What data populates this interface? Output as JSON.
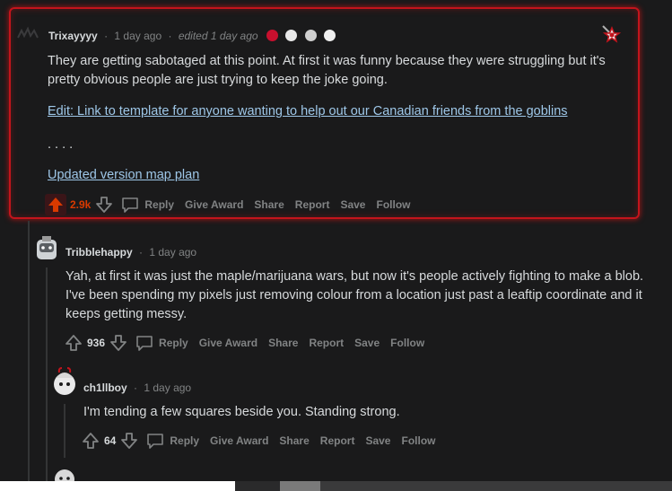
{
  "comments": [
    {
      "username": "Trixayyyy",
      "time": "1 day ago",
      "edited": "edited 1 day ago",
      "body": "They are getting sabotaged at this point. At first it was funny because they were struggling but it's pretty obvious people are just trying to keep the joke going.",
      "link1": "Edit: Link to template for anyone wanting to help out our Canadian friends from the goblins",
      "dots": ". . . .",
      "link2": "Updated version map plan",
      "score": "2.9k",
      "actions": {
        "reply": "Reply",
        "give_award": "Give Award",
        "share": "Share",
        "report": "Report",
        "save": "Save",
        "follow": "Follow"
      }
    },
    {
      "username": "Tribblehappy",
      "time": "1 day ago",
      "body": "Yah, at first it was just the maple/marijuana wars, but now it's people actively fighting to make a blob. I've been spending my pixels just removing colour from a location just past a leaftip coordinate and it keeps getting messy.",
      "score": "936",
      "actions": {
        "reply": "Reply",
        "give_award": "Give Award",
        "share": "Share",
        "report": "Report",
        "save": "Save",
        "follow": "Follow"
      }
    },
    {
      "username": "ch1llboy",
      "time": "1 day ago",
      "body": "I'm tending a few squares beside you. Standing strong.",
      "score": "64",
      "actions": {
        "reply": "Reply",
        "give_award": "Give Award",
        "share": "Share",
        "report": "Report",
        "save": "Save",
        "follow": "Follow"
      }
    }
  ],
  "colors": {
    "accent_red": "#c3141c",
    "link": "#9ec7e8",
    "upvote_active": "#d93a00"
  }
}
